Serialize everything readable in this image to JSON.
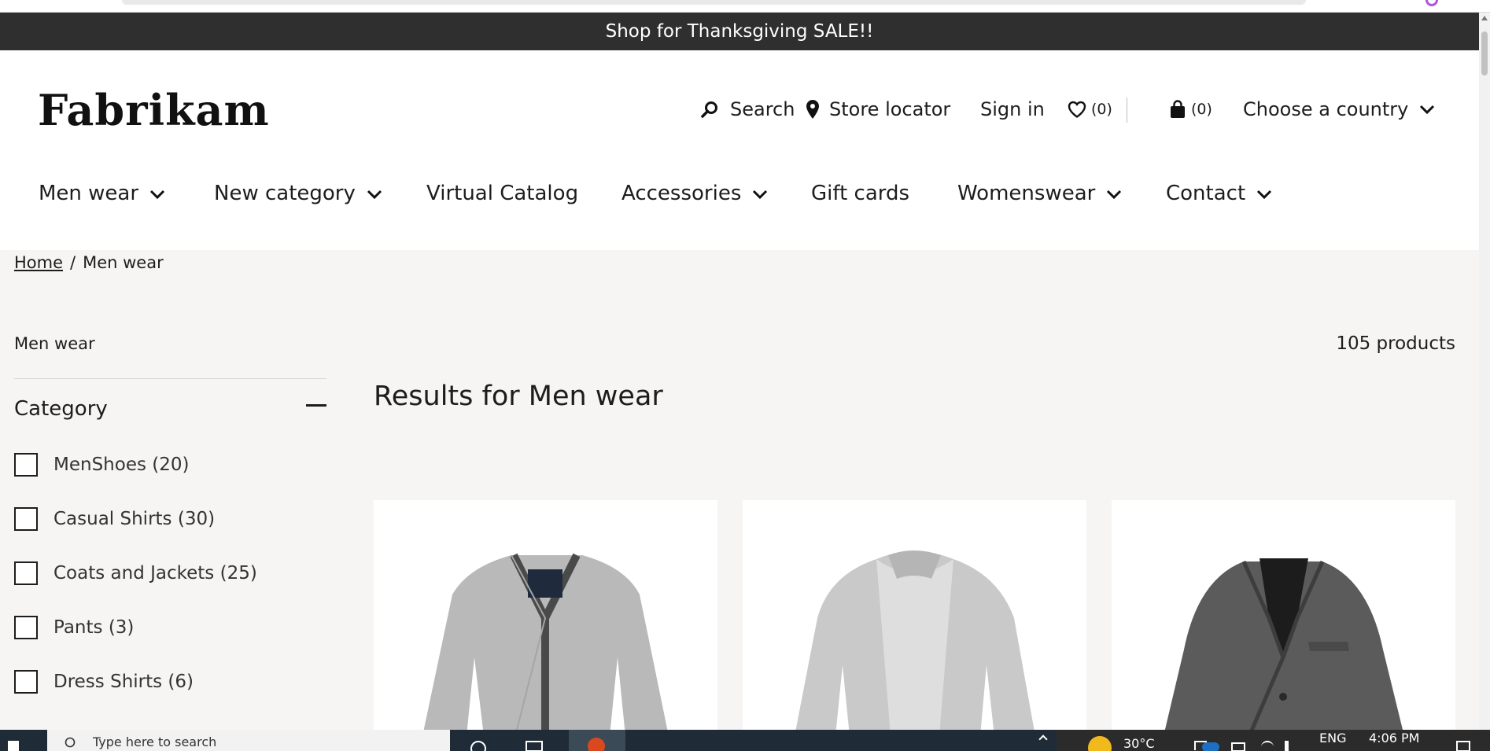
{
  "promo": {
    "text": "Shop for Thanksgiving SALE!!"
  },
  "header": {
    "logo": "Fabrikam",
    "search_label": "Search",
    "store_locator_label": "Store locator",
    "sign_in_label": "Sign in",
    "wishlist_count": "(0)",
    "cart_count": "(0)",
    "country_label": "Choose a country"
  },
  "nav": {
    "items": [
      {
        "label": "Men wear",
        "dropdown": true
      },
      {
        "label": "New category",
        "dropdown": true
      },
      {
        "label": "Virtual Catalog",
        "dropdown": false
      },
      {
        "label": "Accessories",
        "dropdown": true
      },
      {
        "label": "Gift cards",
        "dropdown": false
      },
      {
        "label": "Womenswear",
        "dropdown": true
      },
      {
        "label": "Contact",
        "dropdown": true
      }
    ]
  },
  "breadcrumb": {
    "home": "Home",
    "separator": "/",
    "current": "Men wear"
  },
  "sidebar": {
    "title": "Men wear",
    "category_heading": "Category",
    "facets": [
      {
        "label": "MenShoes (20)",
        "checked": false
      },
      {
        "label": "Casual Shirts (30)",
        "checked": false
      },
      {
        "label": "Coats and Jackets (25)",
        "checked": false
      },
      {
        "label": "Pants (3)",
        "checked": false
      },
      {
        "label": "Dress Shirts (6)",
        "checked": false
      }
    ]
  },
  "results": {
    "product_count": "105 products",
    "heading": "Results for Men wear"
  },
  "products": [
    {
      "image": "grey-cardigan-dark-trim"
    },
    {
      "image": "light-grey-open-cardigan"
    },
    {
      "image": "charcoal-tweed-blazer"
    }
  ],
  "taskbar": {
    "search_placeholder": "Type here to search",
    "temperature": "30°C",
    "language": "ENG",
    "time": "4:06 PM"
  },
  "colors": {
    "promo_bg": "#2f2f2f",
    "page_bg": "#f6f5f3",
    "header_bg": "#ffffff",
    "text": "#1d1d1d"
  }
}
